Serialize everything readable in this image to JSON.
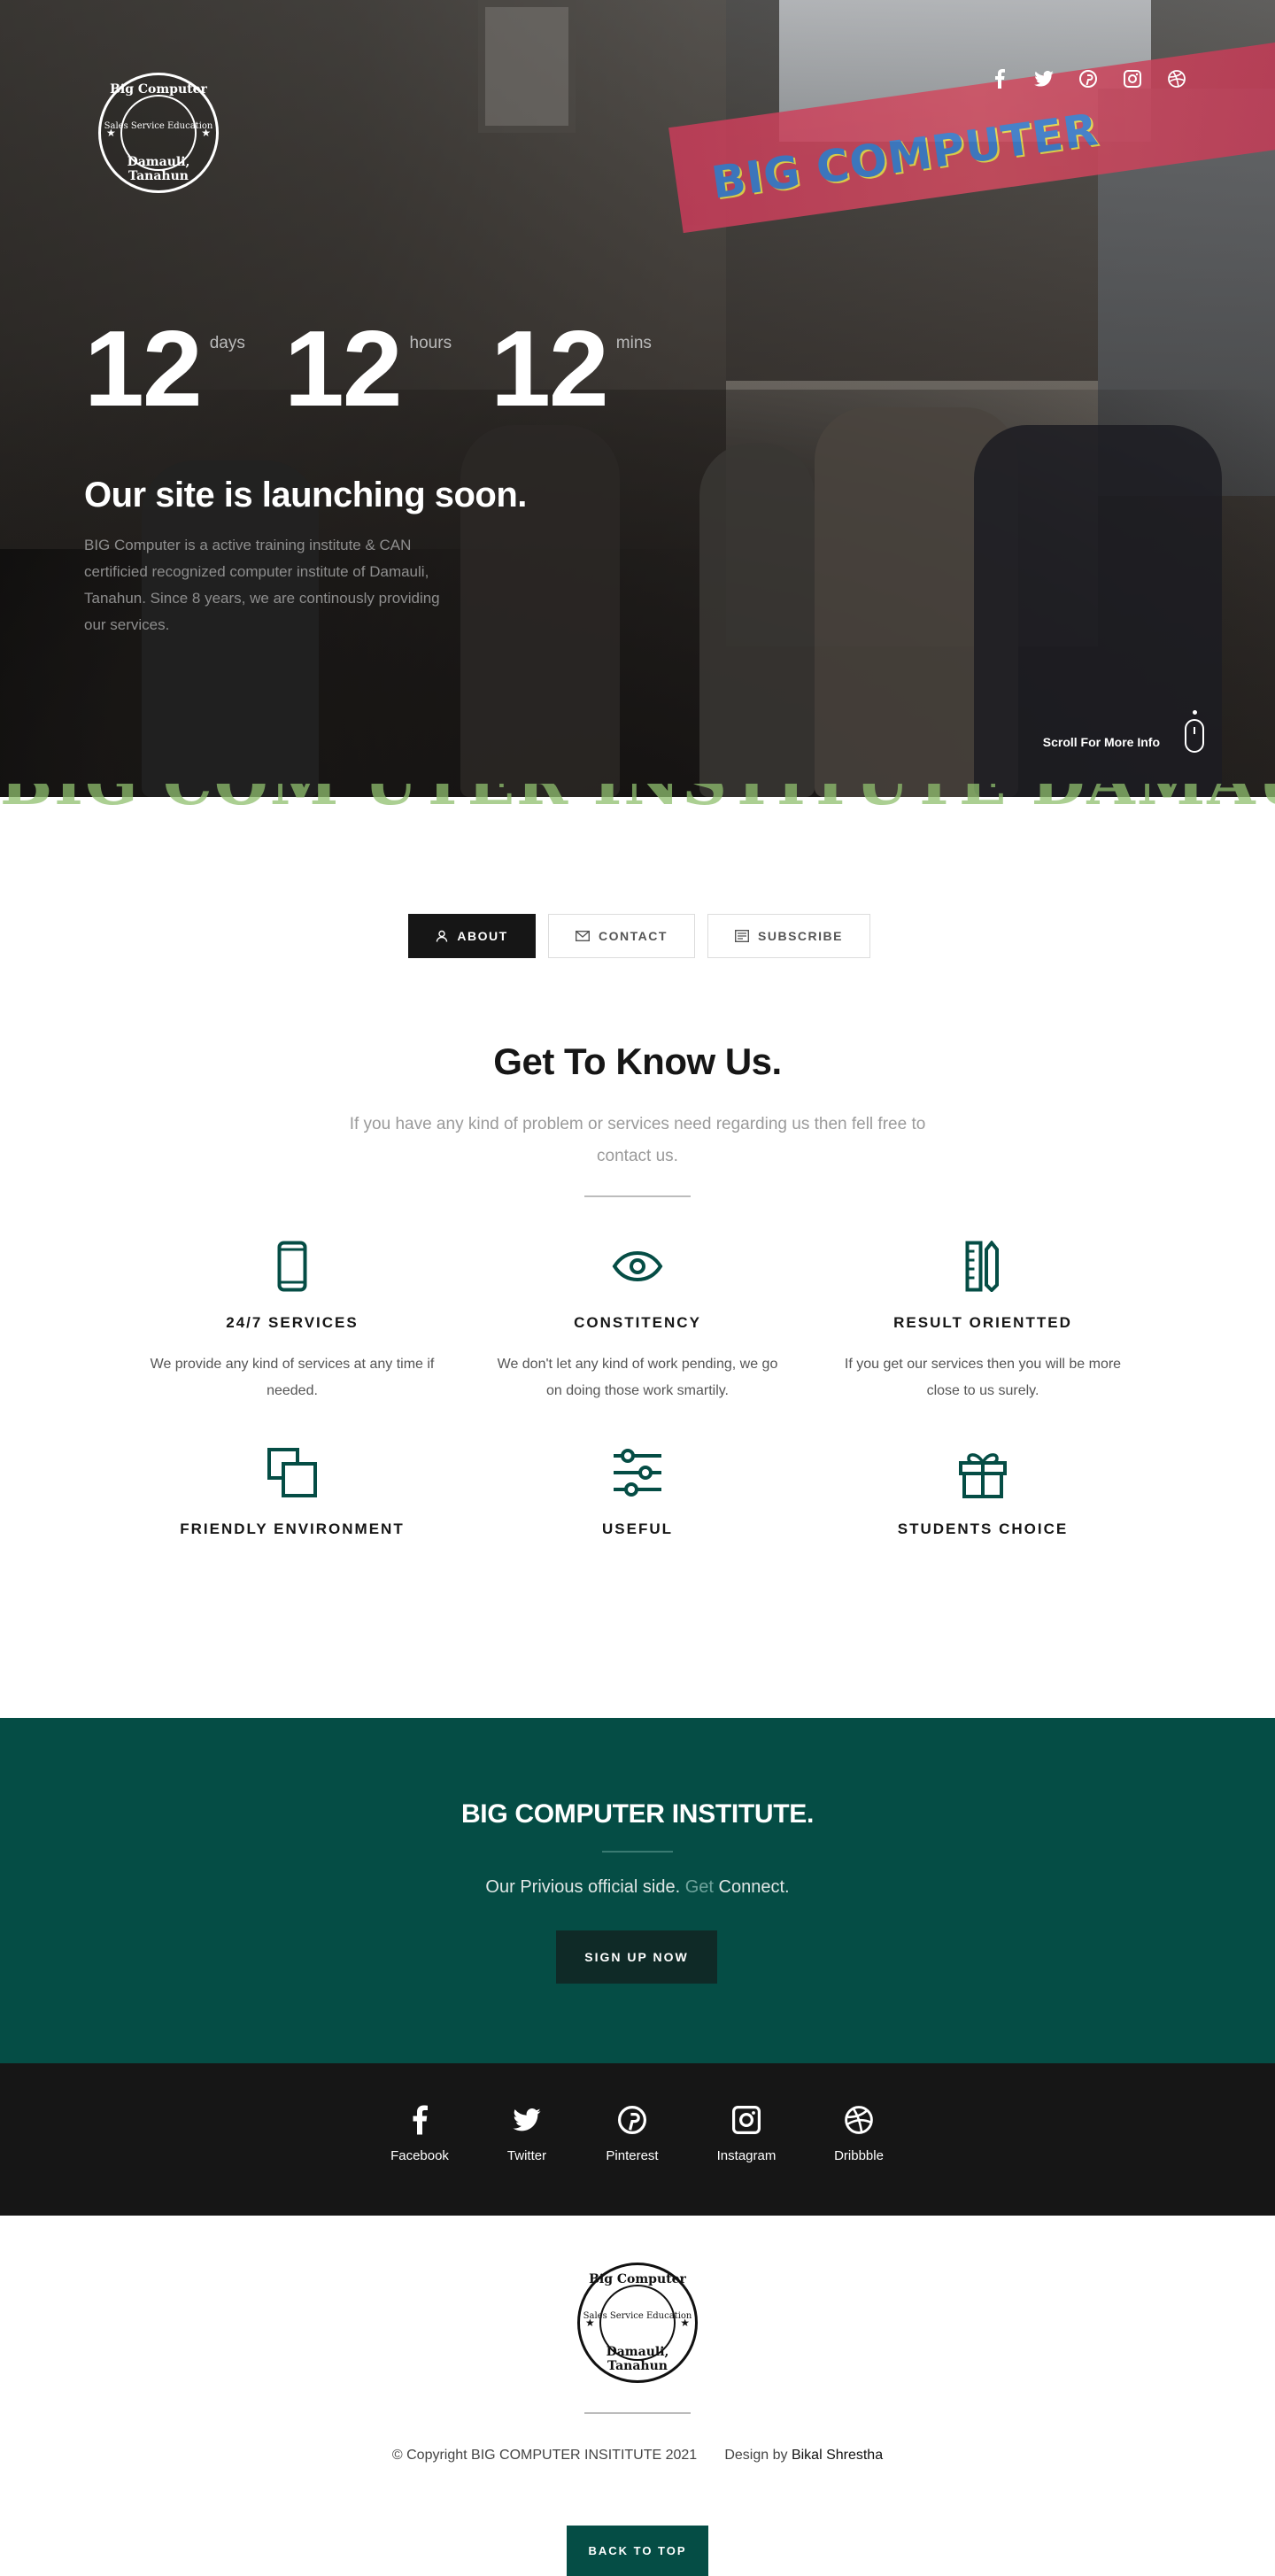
{
  "hero": {
    "logo": {
      "top_text": "Big Computer",
      "bottom_text": "Damauli, Tanahun",
      "center_text": "Sales Service Education"
    },
    "banner_text": "BIG COMPUTER",
    "social_icons": [
      "facebook-icon",
      "twitter-icon",
      "pinterest-icon",
      "instagram-icon",
      "dribbble-icon"
    ],
    "countdown": [
      {
        "value": "12",
        "unit": "days"
      },
      {
        "value": "12",
        "unit": "hours"
      },
      {
        "value": "12",
        "unit": "mins"
      }
    ],
    "title": "Our site is launching soon.",
    "description": "BIG Computer is a active training institute & CAN certificied recognized computer institute of Damauli, Tanahun. Since 8 years, we are continously providing our services.",
    "scroll_label": "Scroll For More Info"
  },
  "tabs": [
    {
      "label": "ABOUT",
      "icon": "user-icon",
      "active": true
    },
    {
      "label": "CONTACT",
      "icon": "mail-icon",
      "active": false
    },
    {
      "label": "SUBSCRIBE",
      "icon": "newsletter-icon",
      "active": false
    }
  ],
  "about": {
    "title": "Get To Know Us.",
    "subtitle": "If you have any kind of problem or services need regarding us then fell free to contact us.",
    "features": [
      {
        "icon": "phone-icon",
        "title": "24/7 SERVICES",
        "desc": "We provide any kind of services at any time if needed."
      },
      {
        "icon": "eye-icon",
        "title": "CONSTITENCY",
        "desc": "We don't let any kind of work pending, we go on doing those work smartily."
      },
      {
        "icon": "pencil-ruler-icon",
        "title": "RESULT ORIENTTED",
        "desc": "If you get our services then you will be more close to us surely."
      },
      {
        "icon": "layers-icon",
        "title": "FRIENDLY ENVIRONMENT",
        "desc": ""
      },
      {
        "icon": "sliders-icon",
        "title": "USEFUL",
        "desc": ""
      },
      {
        "icon": "gift-icon",
        "title": "STUDENTS CHOICE",
        "desc": ""
      }
    ]
  },
  "cta": {
    "title": "BIG COMPUTER INSTITUTE.",
    "text_before": "Our Privious official side.",
    "text_accent": "Get",
    "text_after": "Connect.",
    "button": "SIGN UP NOW"
  },
  "footer_social": [
    {
      "icon": "facebook-icon",
      "label": "Facebook"
    },
    {
      "icon": "twitter-icon",
      "label": "Twitter"
    },
    {
      "icon": "pinterest-icon",
      "label": "Pinterest"
    },
    {
      "icon": "instagram-icon",
      "label": "Instagram"
    },
    {
      "icon": "dribbble-icon",
      "label": "Dribbble"
    }
  ],
  "footer": {
    "copyright": "© Copyright BIG COMPUTER INSITITUTE 2021",
    "design_prefix": "Design by",
    "designer": "Bikal Shrestha",
    "back_to_top": "BACK TO TOP"
  },
  "colors": {
    "brand_green": "#054d45",
    "dark": "#161616",
    "muted_text": "#9a9a9a"
  }
}
